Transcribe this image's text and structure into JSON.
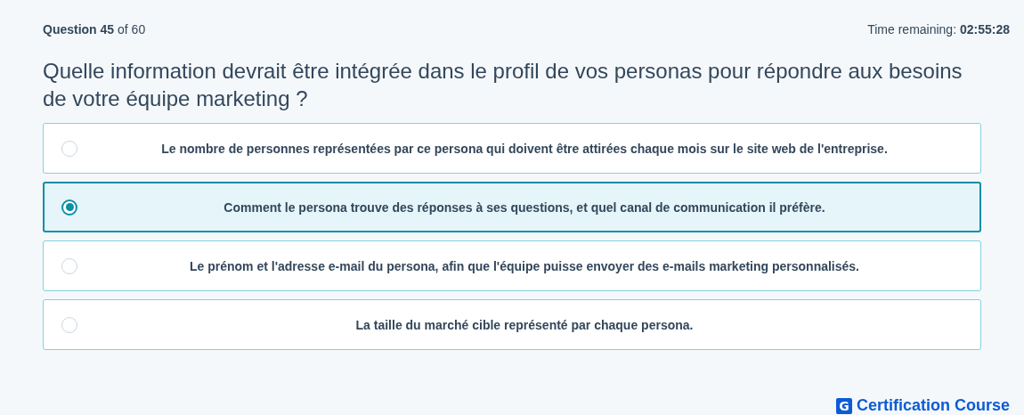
{
  "header": {
    "progress": "**Question 45** of 60",
    "timer": "Time remaining: **02:55:28**"
  },
  "question": "Quelle information devrait être intégrée dans le profil de vos personas pour répondre aux besoins de votre équipe marketing ?",
  "options": [
    {
      "text": "Le nombre de personnes représentées par ce persona qui doivent être attirées chaque mois sur le site web de l'entreprise.",
      "selected": false
    },
    {
      "text": "Comment le persona trouve des réponses à ses questions, et quel canal de communication il préfère.",
      "selected": true
    },
    {
      "text": "Le prénom et l'adresse e-mail du persona, afin que l'équipe puisse envoyer des e-mails marketing personnalisés.",
      "selected": false
    },
    {
      "text": "La taille du marché cible représenté par chaque persona.",
      "selected": false
    }
  ],
  "brand": {
    "letter": "G",
    "name": "Certification Course"
  }
}
